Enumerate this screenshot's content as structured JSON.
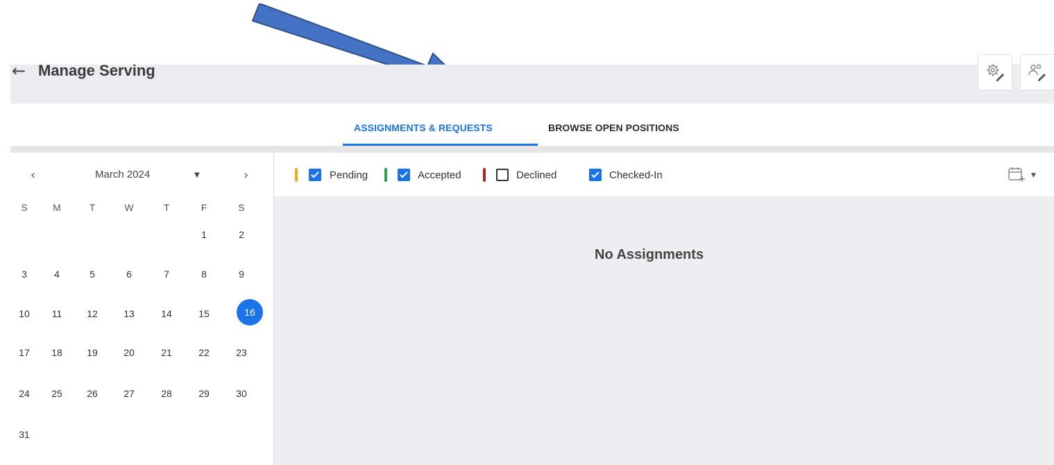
{
  "header": {
    "title": "Manage Serving",
    "back_icon": "arrow-left-icon",
    "actions": [
      {
        "icon": "gear-edit-icon"
      },
      {
        "icon": "people-edit-icon"
      }
    ]
  },
  "tabs": [
    {
      "label": "ASSIGNMENTS & REQUESTS",
      "active": true
    },
    {
      "label": "BROWSE OPEN POSITIONS",
      "active": false
    }
  ],
  "calendar": {
    "month_label": "March 2024",
    "prev_icon": "chevron-left-icon",
    "next_icon": "chevron-right-icon",
    "weekdays": [
      "S",
      "M",
      "T",
      "W",
      "T",
      "F",
      "S"
    ],
    "weeks": [
      [
        "",
        "",
        "",
        "",
        "",
        "1",
        "2"
      ],
      [
        "3",
        "4",
        "5",
        "6",
        "7",
        "8",
        "9"
      ],
      [
        "10",
        "11",
        "12",
        "13",
        "14",
        "15",
        "16"
      ],
      [
        "17",
        "18",
        "19",
        "20",
        "21",
        "22",
        "23"
      ],
      [
        "24",
        "25",
        "26",
        "27",
        "28",
        "29",
        "30"
      ],
      [
        "31",
        "",
        "",
        "",
        "",
        "",
        ""
      ]
    ],
    "selected_day": "16"
  },
  "filters": [
    {
      "label": "Pending",
      "checked": true,
      "color": "#f2a81d"
    },
    {
      "label": "Accepted",
      "checked": true,
      "color": "#2e9e4f"
    },
    {
      "label": "Declined",
      "checked": false,
      "color": "#b3261e"
    },
    {
      "label": "Checked-In",
      "checked": true,
      "color": null
    }
  ],
  "calendar_add_icon": "calendar-add-icon",
  "empty_state": "No Assignments",
  "colors": {
    "accent": "#1a73e8",
    "annotation_arrow": "#4472c4"
  }
}
